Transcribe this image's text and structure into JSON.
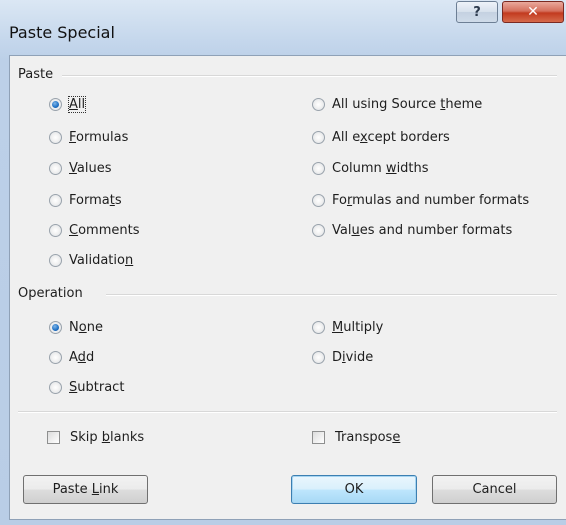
{
  "window": {
    "title": "Paste Special",
    "help_glyph": "?",
    "close_glyph": "✕"
  },
  "paste": {
    "heading": "Paste",
    "selected": "All",
    "left": [
      {
        "pre": "",
        "key": "A",
        "post": "ll",
        "checked": true
      },
      {
        "pre": "",
        "key": "F",
        "post": "ormulas",
        "checked": false
      },
      {
        "pre": "",
        "key": "V",
        "post": "alues",
        "checked": false
      },
      {
        "pre": "Forma",
        "key": "t",
        "post": "s",
        "checked": false
      },
      {
        "pre": "",
        "key": "C",
        "post": "omments",
        "checked": false
      },
      {
        "pre": "Validatio",
        "key": "n",
        "post": "",
        "checked": false
      }
    ],
    "right": [
      {
        "pre": "All using Source ",
        "key": "t",
        "post": "heme",
        "checked": false
      },
      {
        "pre": "All e",
        "key": "x",
        "post": "cept borders",
        "checked": false
      },
      {
        "pre": "Column ",
        "key": "w",
        "post": "idths",
        "checked": false
      },
      {
        "pre": "Fo",
        "key": "r",
        "post": "mulas and number formats",
        "checked": false
      },
      {
        "pre": "Val",
        "key": "u",
        "post": "es and number formats",
        "checked": false
      }
    ]
  },
  "operation": {
    "heading": "Operation",
    "selected": "None",
    "left": [
      {
        "pre": "N",
        "key": "o",
        "post": "ne",
        "checked": true
      },
      {
        "pre": "A",
        "key": "d",
        "post": "d",
        "checked": false
      },
      {
        "pre": "",
        "key": "S",
        "post": "ubtract",
        "checked": false
      }
    ],
    "right": [
      {
        "pre": "",
        "key": "M",
        "post": "ultiply",
        "checked": false
      },
      {
        "pre": "D",
        "key": "i",
        "post": "vide",
        "checked": false
      }
    ]
  },
  "checkboxes": {
    "skip_blanks": {
      "pre": "Skip ",
      "key": "b",
      "post": "lanks",
      "checked": false
    },
    "transpose": {
      "pre": "Transpos",
      "key": "e",
      "post": "",
      "checked": false
    }
  },
  "buttons": {
    "paste_link": {
      "pre": "Paste ",
      "key": "L",
      "post": "ink"
    },
    "ok": "OK",
    "cancel": "Cancel"
  },
  "colors": {
    "title_bar": "#c5d7ec",
    "close_button": "#c23a1f",
    "radio_selected": "#1d6fc4",
    "default_button_border": "#3c7fb1"
  },
  "icons": {
    "help": "help-icon",
    "close": "close-icon"
  }
}
